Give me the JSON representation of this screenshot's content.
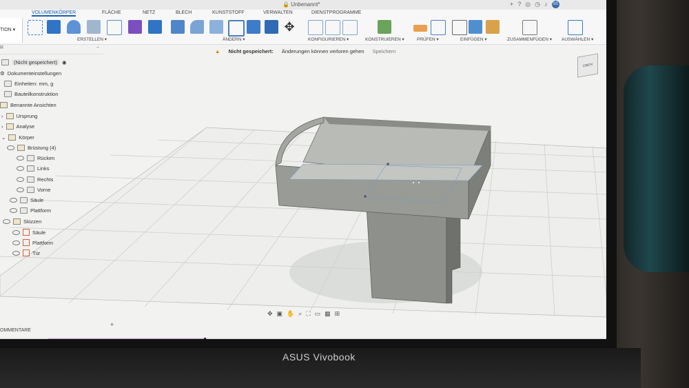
{
  "window": {
    "title": "Unbenannt*"
  },
  "titlebar": {
    "icons": [
      "plus-icon",
      "help-icon",
      "globe-icon",
      "activity-icon",
      "bell-icon"
    ],
    "avatar": "SS"
  },
  "ribbon": {
    "mode": "TION ▾",
    "tabs": [
      "VOLUMENKÖRPER",
      "FLÄCHE",
      "NETZ",
      "BLECH",
      "KUNSTSTOFF",
      "VERWALTEN",
      "DIENSTPROGRAMME"
    ],
    "groups": [
      "ERSTELLEN ▾",
      "ÄNDERN ▾",
      "KONFIGURIEREN ▾",
      "KONSTRUIEREN ▾",
      "PRÜFEN ▾",
      "EINFÜGEN ▾",
      "ZUSAMMENFÜGEN ▾",
      "AUSWÄHLEN ▾"
    ]
  },
  "notice": {
    "label": "Nicht gespeichert:",
    "message": "Änderungen können verloren gehen",
    "action": "Speichern"
  },
  "browser": {
    "header": "R",
    "collapse": "−",
    "root": "(Nicht gespeichert)",
    "items": [
      "Dokumenteinstellungen",
      "Einheiten: mm, g",
      "Bauteilkonstruktion",
      "Benannte Ansichten",
      "Ursprung",
      "Analyse",
      "Körper",
      "Brüstung (4)",
      "Rücken",
      "Links",
      "Rechts",
      "Vorne",
      "Säule",
      "Plattform",
      "Skizzen",
      "Säule",
      "Plattform",
      "Tür"
    ]
  },
  "footer": {
    "comments": "OMMENTARE",
    "add": "+"
  },
  "laptop": {
    "brand": "ASUS Vivobook"
  },
  "colors": {
    "accent": "#1b5fb0",
    "warning": "#d97a00",
    "model": "#8f918c",
    "timeline": "#c99bd6"
  }
}
